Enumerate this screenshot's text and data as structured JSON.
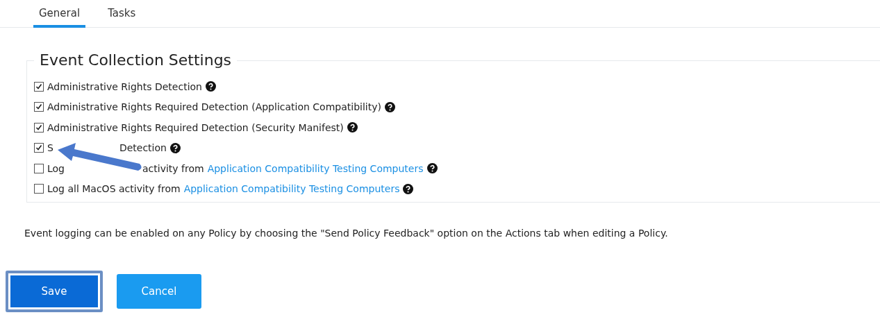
{
  "tabs": [
    {
      "label": "General",
      "selected": true
    },
    {
      "label": "Tasks",
      "selected": false
    }
  ],
  "section": {
    "title": "Event Collection Settings",
    "options": [
      {
        "segments": [
          "Administrative Rights Detection"
        ],
        "checked": true
      },
      {
        "segments": [
          "Administrative Rights Required Detection (Application Compatibility)"
        ],
        "checked": true
      },
      {
        "segments": [
          "Administrative Rights Required Detection (Security Manifest)"
        ],
        "checked": true
      },
      {
        "segments": [
          "S",
          "Detection"
        ],
        "checked": true
      },
      {
        "segments": [
          "Log",
          "activity from"
        ],
        "link": "Application Compatibility Testing Computers",
        "checked": false
      },
      {
        "segments": [
          "Log all MacOS activity from"
        ],
        "link": "Application Compatibility Testing Computers",
        "checked": false
      }
    ]
  },
  "note": "Event logging can be enabled on any Policy by choosing the \"Send Policy Feedback\" option on the Actions tab when editing a Policy.",
  "buttons": [
    {
      "label": "Save",
      "kind": "primary",
      "focused": true
    },
    {
      "label": "Cancel",
      "kind": "secondary",
      "focused": false
    }
  ]
}
